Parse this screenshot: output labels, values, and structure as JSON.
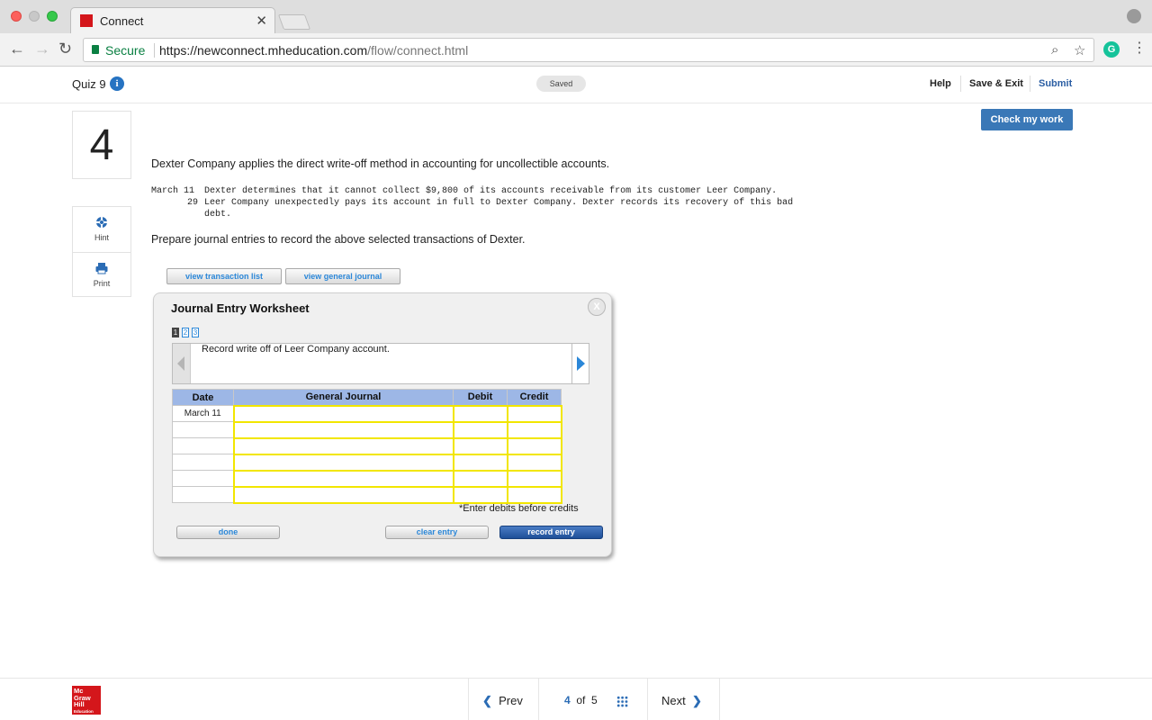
{
  "browser": {
    "tab_title": "Connect",
    "secure_label": "Secure",
    "url_host": "https://newconnect.mheducation.com",
    "url_path": "/flow/connect.html"
  },
  "header": {
    "quiz_title": "Quiz 9",
    "saved_status": "Saved",
    "help": "Help",
    "save_exit": "Save & Exit",
    "submit": "Submit",
    "check_my_work": "Check my work"
  },
  "question": {
    "number": "4",
    "intro": "Dexter Company applies the direct write-off method in accounting for uncollectible accounts.",
    "transactions": [
      {
        "date": "March 11",
        "text": "Dexter determines that it cannot collect $9,800 of its accounts receivable from its customer Leer Company."
      },
      {
        "date": "29",
        "text": "Leer Company unexpectedly pays its account in full to Dexter Company. Dexter records its recovery of this bad"
      },
      {
        "date": "",
        "text": "debt."
      }
    ],
    "instruction": "Prepare journal entries to record the above selected transactions of Dexter."
  },
  "sidebar": {
    "hint": "Hint",
    "print": "Print"
  },
  "buttons": {
    "view_transaction_list": "view transaction list",
    "view_general_journal": "view general journal"
  },
  "worksheet": {
    "title": "Journal Entry Worksheet",
    "close": "X",
    "pages": [
      "1",
      "2",
      "3"
    ],
    "current_page": 1,
    "description": "Record write off of Leer Company account.",
    "columns": [
      "Date",
      "General Journal",
      "Debit",
      "Credit"
    ],
    "rows": [
      {
        "date": "March 11"
      },
      {
        "date": ""
      },
      {
        "date": ""
      },
      {
        "date": ""
      },
      {
        "date": ""
      },
      {
        "date": ""
      }
    ],
    "note": "*Enter debits before credits",
    "done": "done",
    "clear_entry": "clear entry",
    "record_entry": "record entry"
  },
  "footer": {
    "logo_lines": [
      "Mc",
      "Graw",
      "Hill",
      "Education"
    ],
    "prev": "Prev",
    "current": "4",
    "of": "of",
    "total": "5",
    "next": "Next"
  }
}
